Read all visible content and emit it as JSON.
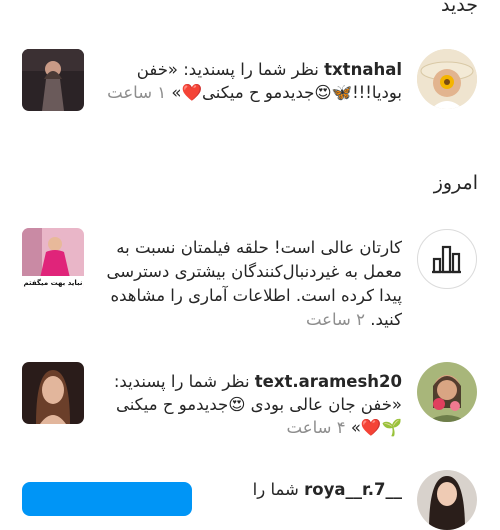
{
  "sections": {
    "new_title": "جدید",
    "today_title": "امروز"
  },
  "notifications": [
    {
      "username": "txtnahal",
      "action": " نظر شما را پسندید: ",
      "comment": "«خفن بودیا!!!🦋😍جدیدمو ح میکنی❤️»",
      "time": "۱ ساعت"
    },
    {
      "message": "کارتان عالی است! حلقه فیلمتان نسبت به معمل به غیردنبال‌کنندگان بیشتری دسترسی پیدا کرده است. اطلاعات آماری را مشاهده کنید.",
      "time": "۲ ساعت",
      "icon": "bar-chart-icon"
    },
    {
      "username": "text.aramesh20",
      "action": " نظر شما را پسندید: ",
      "comment": "«خفن جان عالی بودی 😍جدیدمو ح میکنی🌱❤️»",
      "time": "۴ ساعت"
    },
    {
      "username": "__roya__r.7",
      "action": " شما را"
    }
  ],
  "thumb2_caption": "نباید بهت میگفتم ولی..."
}
